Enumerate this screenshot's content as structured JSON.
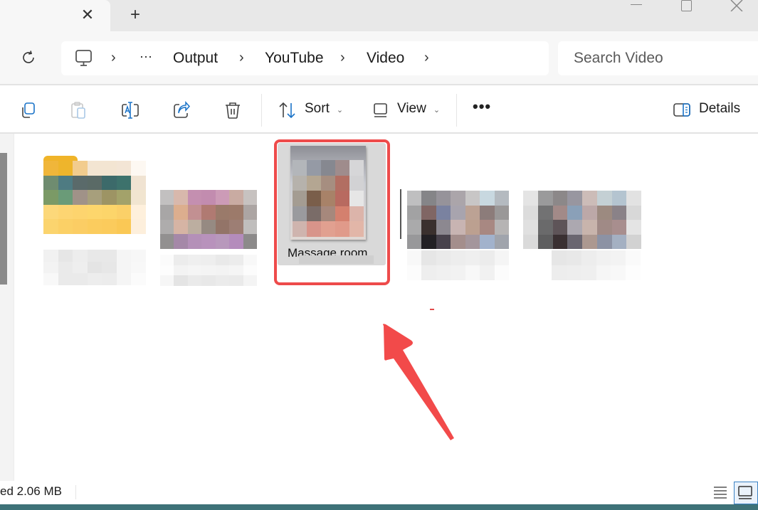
{
  "window": {
    "tab_close_glyph": "✕",
    "new_tab_glyph": "+"
  },
  "address_bar": {
    "breadcrumb": [
      "Output",
      "YouTube",
      "Video"
    ],
    "overflow_glyph": "···",
    "separator_glyph": "›"
  },
  "search": {
    "placeholder": "Search Video"
  },
  "command_bar": {
    "sort_label": "Sort",
    "view_label": "View",
    "more_glyph": "•••",
    "details_label": "Details",
    "chevron_glyph": "⌄",
    "accent_color": "#1a73c8"
  },
  "files": [
    {
      "type": "folder",
      "label": "",
      "blurred": true
    },
    {
      "type": "video",
      "label": "",
      "blurred": true
    },
    {
      "type": "video",
      "label": "Massage room",
      "blurred": true,
      "selected": true
    },
    {
      "type": "video",
      "label": "",
      "blurred": true
    },
    {
      "type": "video",
      "label": "",
      "blurred": true
    }
  ],
  "annotation": {
    "highlight_color": "#ee4b4b"
  },
  "status_bar": {
    "selection_text": "ed  2.06 MB"
  }
}
